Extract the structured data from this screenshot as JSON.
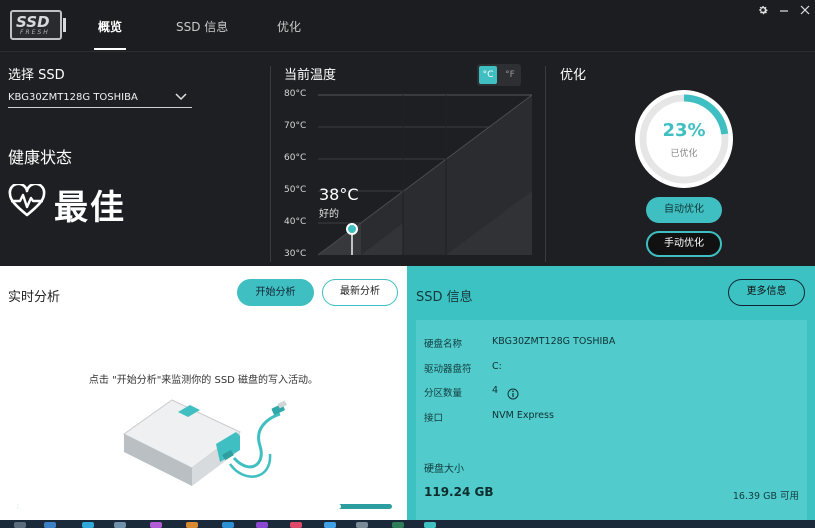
{
  "app": {
    "logo_text": "SSD",
    "logo_sub": "FRESH"
  },
  "nav": {
    "tabs": [
      {
        "label": "概览",
        "active": true
      },
      {
        "label": "SSD 信息",
        "active": false
      },
      {
        "label": "优化",
        "active": false
      }
    ]
  },
  "window_controls": [
    "gear-icon",
    "minimize-icon",
    "close-icon"
  ],
  "select_ssd": {
    "label": "选择 SSD",
    "value": "KBG30ZMT128G TOSHIBA"
  },
  "health": {
    "label": "健康状态",
    "value": "最佳"
  },
  "temperature": {
    "label": "当前温度",
    "unit_c": "°C",
    "unit_f": "°F",
    "selected_unit": "C",
    "ticks": [
      "80°C",
      "70°C",
      "60°C",
      "50°C",
      "40°C",
      "30°C"
    ],
    "value_text": "38°C",
    "value": 38,
    "status": "好的"
  },
  "optimize": {
    "label": "优化",
    "percent_text": "23%",
    "percent": 23,
    "sub_label": "已优化",
    "auto_button": "自动优化",
    "manual_button": "手动优化"
  },
  "realtime": {
    "title": "实时分析",
    "start_button": "开始分析",
    "latest_button": "最新分析",
    "hint": "点击 \"开始分析\"来监测你的 SSD 磁盘的写入活动。"
  },
  "ssd_info": {
    "title": "SSD 信息",
    "more_button": "更多信息",
    "rows": [
      {
        "label": "硬盘名称",
        "value": "KBG30ZMT128G TOSHIBA"
      },
      {
        "label": "驱动器盘符",
        "value": "C:"
      },
      {
        "label": "分区数量",
        "value": "4"
      },
      {
        "label": "接口",
        "value": "NVM Express"
      }
    ],
    "size_label": "硬盘大小",
    "size_value": "119.24 GB",
    "free_value": "16.39 GB 可用",
    "used_fraction": 0.863
  },
  "colors": {
    "accent": "#3fbfc1",
    "panel_dark": "#1e1f23",
    "panel_teal": "#3dc2c3"
  }
}
